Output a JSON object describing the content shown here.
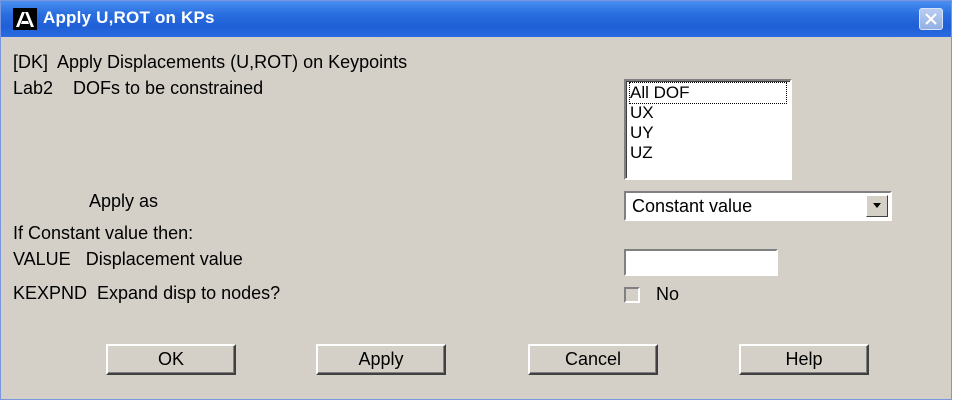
{
  "window": {
    "title": "Apply U,ROT on KPs",
    "app_icon": "ansys-logo-icon",
    "close_icon": "close-icon",
    "colors": {
      "titlebar": "#2a6fe0",
      "background": "#d4d0c8"
    }
  },
  "header": {
    "command_line": "[DK]  Apply Displacements (U,ROT) on Keypoints"
  },
  "lab2": {
    "label": "Lab2    DOFs to be constrained",
    "options": [
      "All DOF",
      "UX",
      "UY",
      "UZ"
    ],
    "selected_index": 0
  },
  "apply_as": {
    "label": "Apply as",
    "selected": "Constant value"
  },
  "constant_note": "If Constant value then:",
  "value_field": {
    "label": "VALUE   Displacement value",
    "value": ""
  },
  "kexpnd": {
    "label": "KEXPND  Expand disp to nodes?",
    "checkbox_label": "No",
    "checked": false
  },
  "buttons": {
    "ok": "OK",
    "apply": "Apply",
    "cancel": "Cancel",
    "help": "Help"
  }
}
